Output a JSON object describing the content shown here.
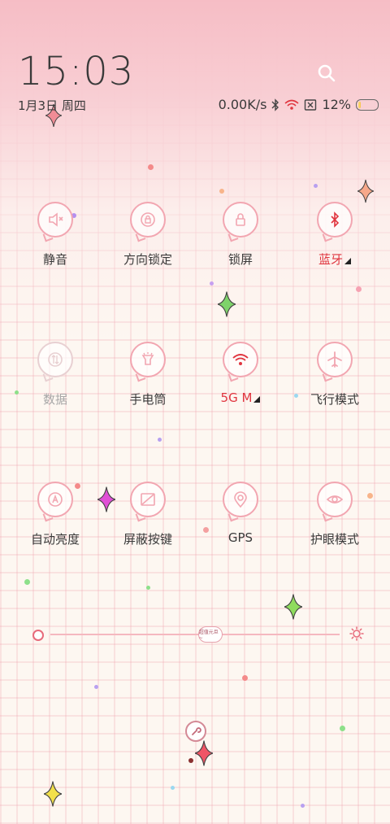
{
  "header": {
    "time": "15:03",
    "date": "1月3日 周四"
  },
  "status_bar": {
    "net_speed": "0.00K/s",
    "battery_percent": "12%",
    "battery_level": 0.12
  },
  "toggles": [
    {
      "label": "静音",
      "icon": "mute-icon",
      "state": "off"
    },
    {
      "label": "方向锁定",
      "icon": "rotation-lock-icon",
      "state": "off"
    },
    {
      "label": "锁屏",
      "icon": "lock-icon",
      "state": "off"
    },
    {
      "label": "蓝牙",
      "icon": "bluetooth-icon",
      "state": "on"
    },
    {
      "label": "数据",
      "icon": "mobile-data-icon",
      "state": "disabled"
    },
    {
      "label": "手电筒",
      "icon": "flashlight-icon",
      "state": "off"
    },
    {
      "label": "5G M",
      "icon": "wifi-icon",
      "state": "on"
    },
    {
      "label": "飞行模式",
      "icon": "airplane-icon",
      "state": "off"
    },
    {
      "label": "自动亮度",
      "icon": "auto-brightness-icon",
      "state": "off"
    },
    {
      "label": "屏蔽按键",
      "icon": "block-keys-icon",
      "state": "off"
    },
    {
      "label": "GPS",
      "icon": "gps-icon",
      "state": "off"
    },
    {
      "label": "护眼模式",
      "icon": "eye-icon",
      "state": "off"
    }
  ],
  "brightness": {
    "level": 0.55,
    "thumb_text": "超值元旦~"
  },
  "colors": {
    "accent": "#e0353f",
    "icon_stroke": "#f2a6b1",
    "text": "#3a3a3a",
    "disabled": "#a8a8a8"
  }
}
